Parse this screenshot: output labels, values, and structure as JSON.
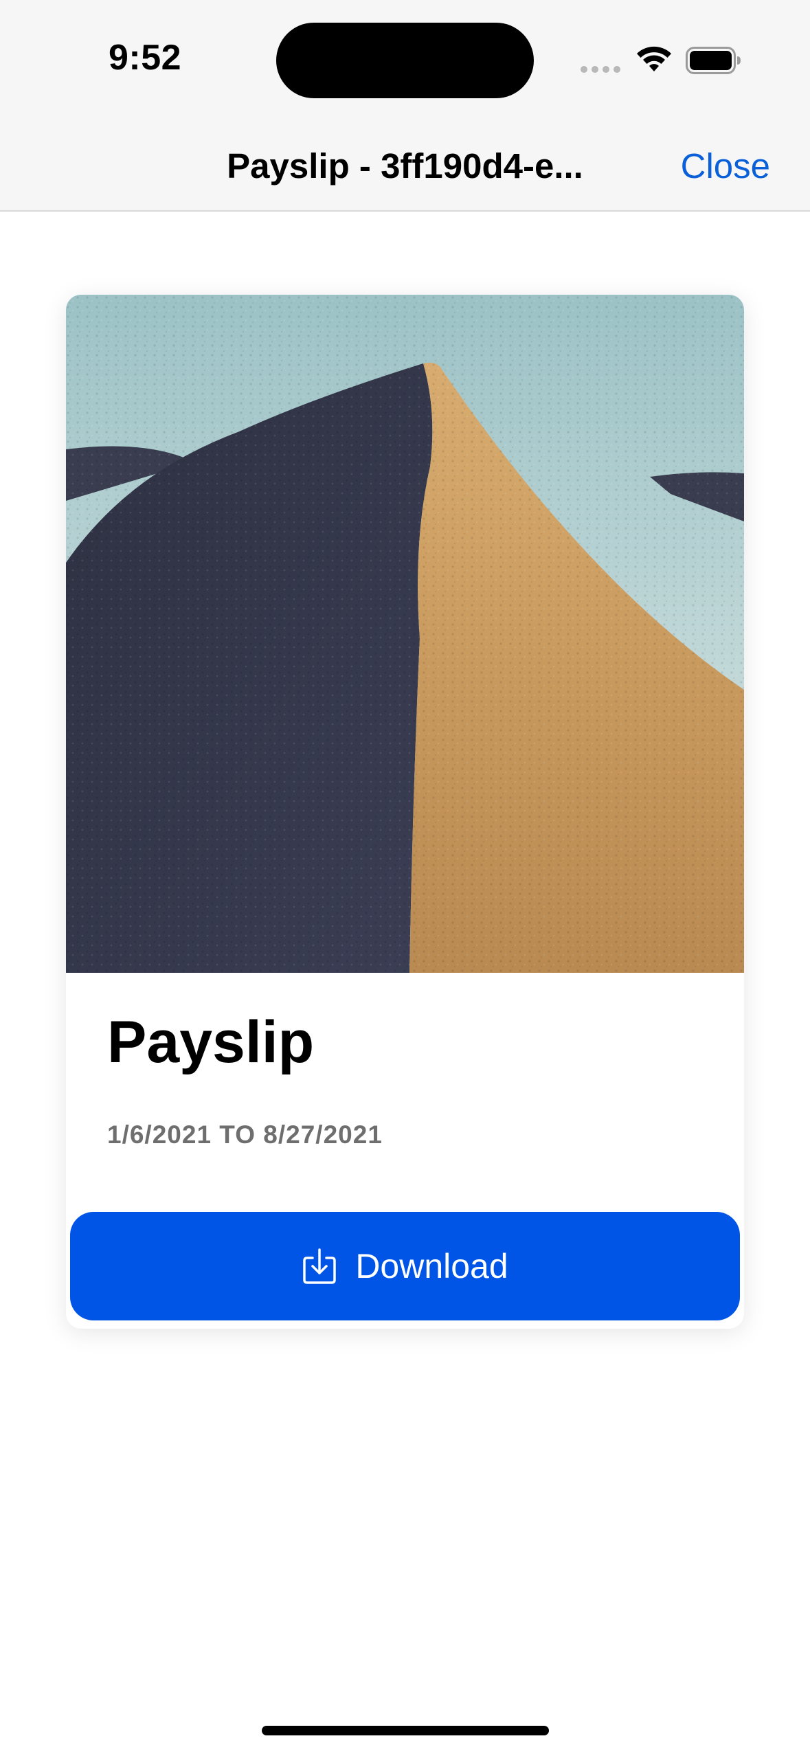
{
  "status_bar": {
    "time": "9:52"
  },
  "nav": {
    "title": "Payslip - 3ff190d4-e...",
    "close_label": "Close"
  },
  "card": {
    "image_alt": "sand-dune-photo",
    "title": "Payslip",
    "date_range": "1/6/2021 TO 8/27/2021",
    "download_label": "Download"
  },
  "colors": {
    "accent": "#0055e6",
    "link": "#0a60d9",
    "secondary_text": "#6e6e6e"
  }
}
